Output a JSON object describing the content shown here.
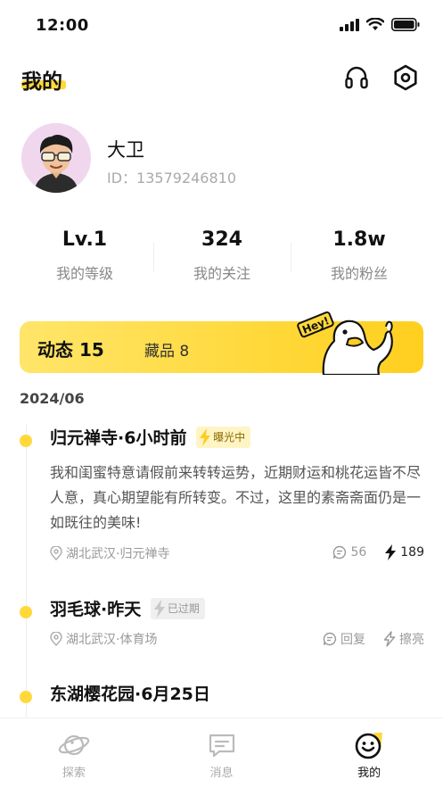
{
  "status_bar": {
    "time": "12:00"
  },
  "header": {
    "title": "我的"
  },
  "profile": {
    "name": "大卫",
    "id_text": "ID：13579246810"
  },
  "stats": [
    {
      "value": "Lv.1",
      "label": "我的等级"
    },
    {
      "value": "324",
      "label": "我的关注"
    },
    {
      "value": "1.8w",
      "label": "我的粉丝"
    }
  ],
  "tabs": {
    "active": "动态 15",
    "inactive": "藏品 8",
    "mascot_text": "Hey!"
  },
  "date_group": "2024/06",
  "posts": [
    {
      "title": "归元禅寺·6小时前",
      "badge": "曝光中",
      "body": "我和闺蜜特意请假前来转转运势，近期财运和桃花运皆不尽人意，真心期望能有所转变。不过，这里的素斋斋面仍是一如既往的美味!",
      "location": "湖北武汉·归元禅寺",
      "comments": "56",
      "boosts": "189"
    },
    {
      "title": "羽毛球·昨天",
      "badge": "已过期",
      "location": "湖北武汉·体育场",
      "reply": "回复",
      "polish": "擦亮"
    },
    {
      "title": "东湖樱花园·6月25日"
    }
  ],
  "bottom_nav": [
    {
      "label": "探索",
      "icon": "planet-icon"
    },
    {
      "label": "消息",
      "icon": "message-icon"
    },
    {
      "label": "我的",
      "icon": "smile-icon"
    }
  ],
  "colors": {
    "accent": "#ffd93a",
    "text_primary": "#111111",
    "text_secondary": "#999999"
  }
}
